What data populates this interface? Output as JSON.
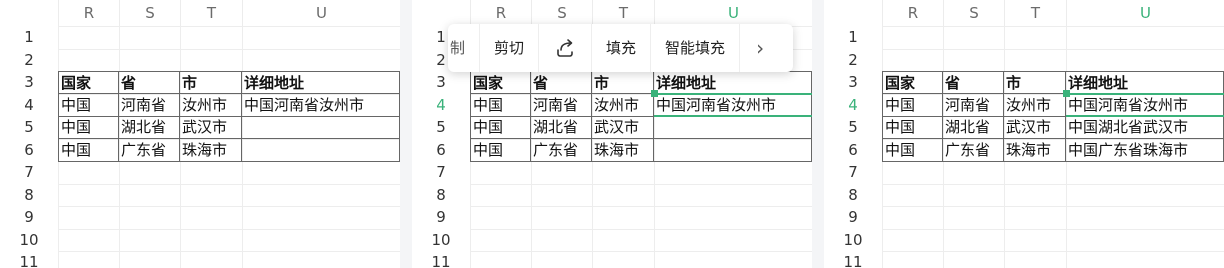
{
  "columns": [
    "R",
    "S",
    "T",
    "U"
  ],
  "rows": [
    "1",
    "2",
    "3",
    "4",
    "5",
    "6",
    "7",
    "8",
    "9",
    "10",
    "11"
  ],
  "table_header": [
    "国家",
    "省",
    "市",
    "详细地址"
  ],
  "panels": [
    {
      "selected_col": null,
      "selected_row": null,
      "data": [
        [
          "中国",
          "河南省",
          "汝州市",
          "中国河南省汝州市"
        ],
        [
          "中国",
          "湖北省",
          "武汉市",
          ""
        ],
        [
          "中国",
          "广东省",
          "珠海市",
          ""
        ]
      ]
    },
    {
      "selected_col": "U",
      "selected_row": "4",
      "data": [
        [
          "中国",
          "河南省",
          "汝州市",
          "中国河南省汝州市"
        ],
        [
          "中国",
          "湖北省",
          "武汉市",
          ""
        ],
        [
          "中国",
          "广东省",
          "珠海市",
          ""
        ]
      ]
    },
    {
      "selected_col": "U",
      "selected_row": "4",
      "data": [
        [
          "中国",
          "河南省",
          "汝州市",
          "中国河南省汝州市"
        ],
        [
          "中国",
          "湖北省",
          "武汉市",
          "中国湖北省武汉市"
        ],
        [
          "中国",
          "广东省",
          "珠海市",
          "中国广东省珠海市"
        ]
      ]
    }
  ],
  "toolbar": {
    "copy_partial": "制",
    "cut": "剪切",
    "share_icon": "share-icon",
    "fill": "填充",
    "smart_fill": "智能填充",
    "more_icon": "chevron-right-icon",
    "more_glyph": "›"
  },
  "colors": {
    "accent": "#3ab27a",
    "grid": "#ededed",
    "border": "#666666"
  }
}
